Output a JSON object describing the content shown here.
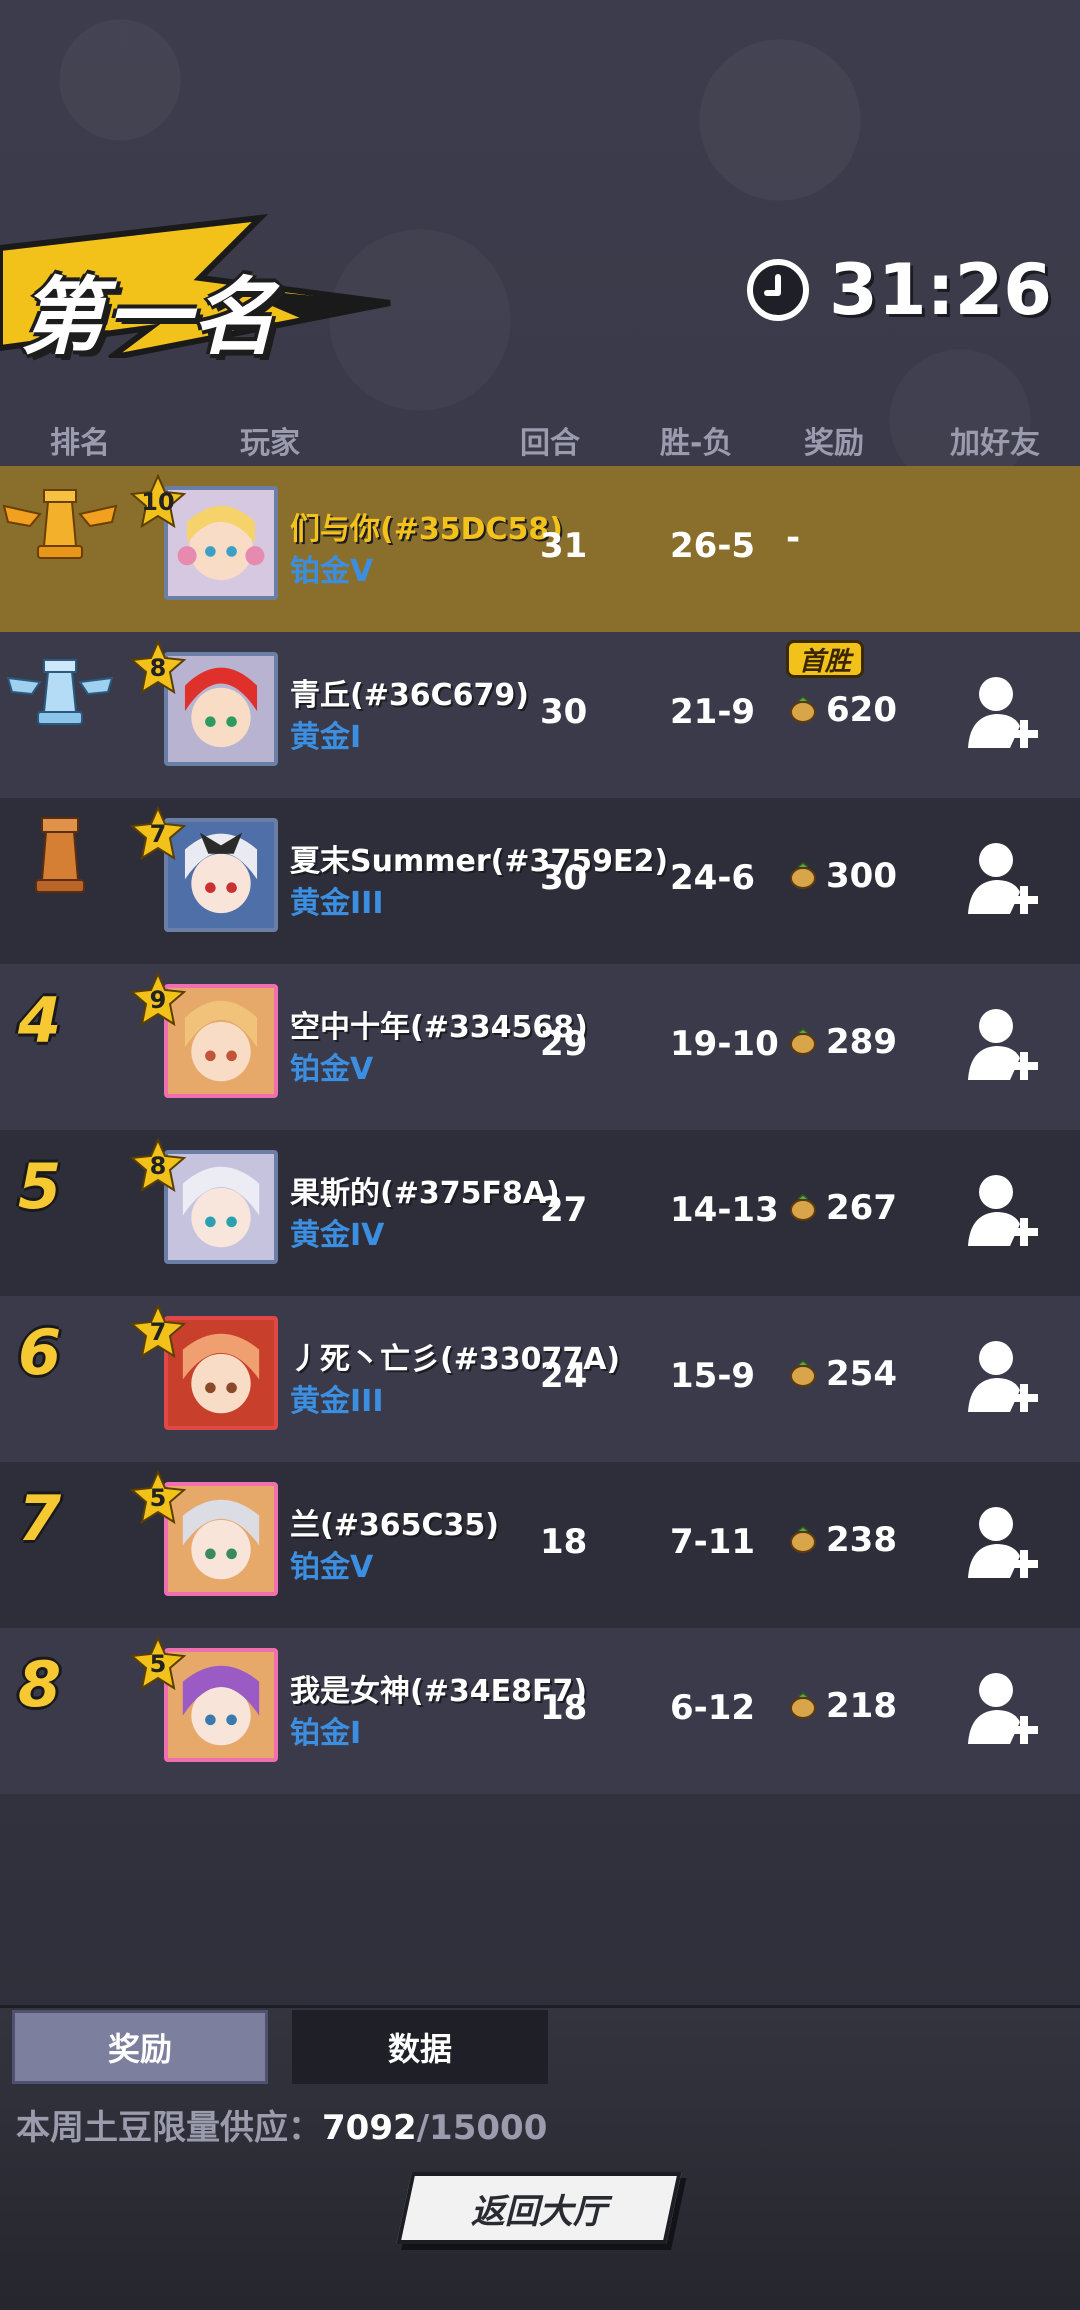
{
  "header": {
    "title": "第一名",
    "timer": "31:26"
  },
  "columns": {
    "rank": "排名",
    "player": "玩家",
    "rounds": "回合",
    "win_loss": "胜-负",
    "reward": "奖励",
    "add_friend": "加好友"
  },
  "rows": [
    {
      "rank": "1",
      "level": "10",
      "name": "们与你(#35DC58)",
      "tier": "铂金V",
      "rounds": "31",
      "win_loss": "26-5",
      "reward": "-"
    },
    {
      "rank": "2",
      "level": "8",
      "name": "青丘(#36C679)",
      "tier": "黄金I",
      "rounds": "30",
      "win_loss": "21-9",
      "reward": "620",
      "badge": "首胜"
    },
    {
      "rank": "3",
      "level": "7",
      "name": "夏末Summer(#3759E2)",
      "tier": "黄金III",
      "rounds": "30",
      "win_loss": "24-6",
      "reward": "300"
    },
    {
      "rank": "4",
      "level": "9",
      "name": "空中十年(#334568)",
      "tier": "铂金V",
      "rounds": "29",
      "win_loss": "19-10",
      "reward": "289"
    },
    {
      "rank": "5",
      "level": "8",
      "name": "果斯的(#375F8A)",
      "tier": "黄金IV",
      "rounds": "27",
      "win_loss": "14-13",
      "reward": "267"
    },
    {
      "rank": "6",
      "level": "7",
      "name": "丿死丶亡彡(#33077A)",
      "tier": "黄金III",
      "rounds": "24",
      "win_loss": "15-9",
      "reward": "254"
    },
    {
      "rank": "7",
      "level": "5",
      "name": "兰(#365C35)",
      "tier": "铂金V",
      "rounds": "18",
      "win_loss": "7-11",
      "reward": "238"
    },
    {
      "rank": "8",
      "level": "5",
      "name": "我是女神(#34E8F7)",
      "tier": "铂金I",
      "rounds": "18",
      "win_loss": "6-12",
      "reward": "218"
    }
  ],
  "tabs": {
    "reward": "奖励",
    "data": "数据"
  },
  "supply": {
    "label": "本周土豆限量供应：",
    "current": "7092",
    "max": "/15000"
  },
  "back_button": "返回大厅",
  "colors": {
    "gold": "#f3c21b",
    "tier_blue": "#3c8fe0",
    "highlight_row": "#8a6f2c"
  }
}
